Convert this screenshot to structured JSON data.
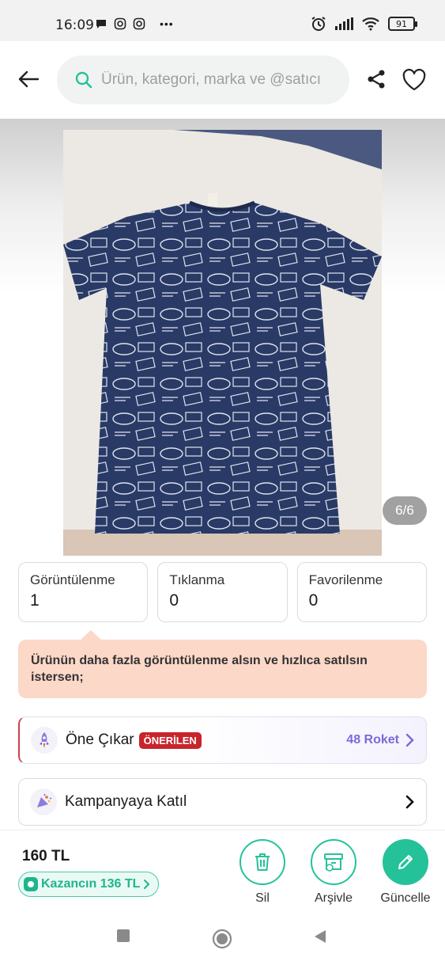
{
  "status_bar": {
    "time": "16:09",
    "battery": "91",
    "overflow": "•••"
  },
  "header": {
    "search_placeholder": "Ürün, kategori, marka ve @satıcı"
  },
  "gallery": {
    "counter": "6/6"
  },
  "stats": [
    {
      "label": "Görüntülenme",
      "value": "1"
    },
    {
      "label": "Tıklanma",
      "value": "0"
    },
    {
      "label": "Favorilenme",
      "value": "0"
    }
  ],
  "promo": {
    "text": "Ürünün daha fazla görüntülenme alsın ve hızlıca satılsın istersen;"
  },
  "feature_row": {
    "label": "Öne Çıkar",
    "badge": "ÖNERİLEN",
    "cost": "48 Roket"
  },
  "campaign_row": {
    "label": "Kampanyaya Katıl"
  },
  "bottom": {
    "price": "160 TL",
    "earn": "Kazancın 136 TL",
    "delete_label": "Sil",
    "archive_label": "Arşivle",
    "update_label": "Güncelle"
  },
  "colors": {
    "accent": "#25c29a",
    "badge": "#c8242c",
    "promo_bg": "#fcd8c8",
    "roket": "#7a6ad8"
  }
}
